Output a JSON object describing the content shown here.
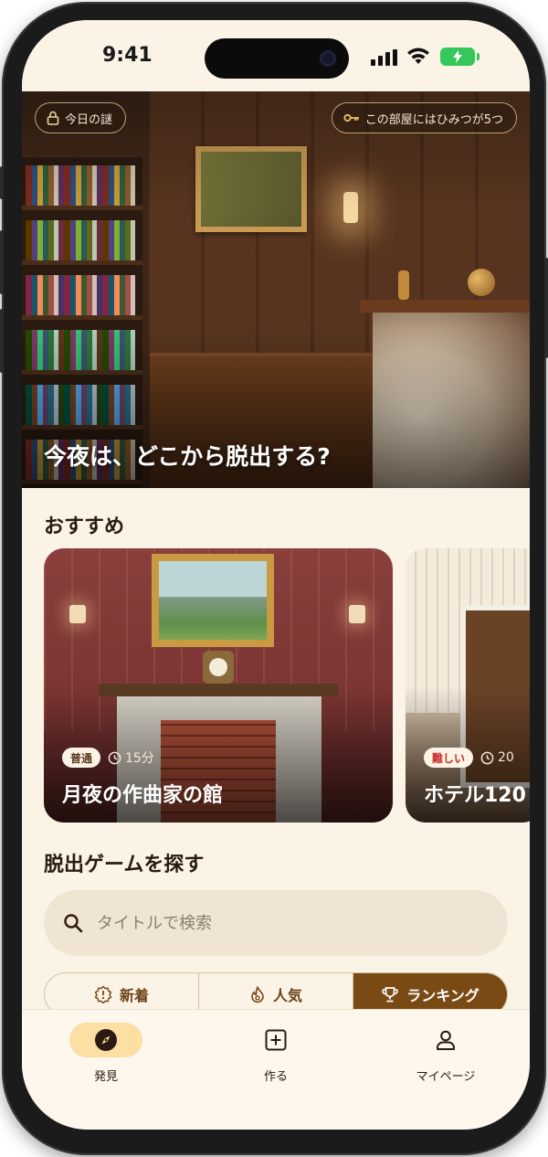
{
  "status_bar": {
    "time": "9:41"
  },
  "hero": {
    "badge_left": "今日の謎",
    "badge_right": "この部屋にはひみつが5つ",
    "title": "今夜は、どこから脱出する?"
  },
  "recommended": {
    "title": "おすすめ",
    "cards": [
      {
        "difficulty": "普通",
        "duration": "15分",
        "title": "月夜の作曲家の館"
      },
      {
        "difficulty": "難しい",
        "duration": "20",
        "title": "ホテル120"
      }
    ]
  },
  "explore": {
    "title": "脱出ゲームを探す",
    "search_placeholder": "タイトルで検索",
    "tabs": [
      {
        "label": "新着",
        "icon": "new-icon",
        "active": false
      },
      {
        "label": "人気",
        "icon": "flame-icon",
        "active": false
      },
      {
        "label": "ランキング",
        "icon": "trophy-icon",
        "active": true
      }
    ]
  },
  "tab_bar": {
    "items": [
      {
        "label": "発見",
        "icon": "compass-icon",
        "active": true
      },
      {
        "label": "作る",
        "icon": "plus-square-icon",
        "active": false
      },
      {
        "label": "マイページ",
        "icon": "user-icon",
        "active": false
      }
    ]
  },
  "colors": {
    "accent": "#7a4a14",
    "background": "#fbf3e6",
    "active_tab_bg": "#fbdfa3",
    "hard_badge": "#c62a2a"
  }
}
